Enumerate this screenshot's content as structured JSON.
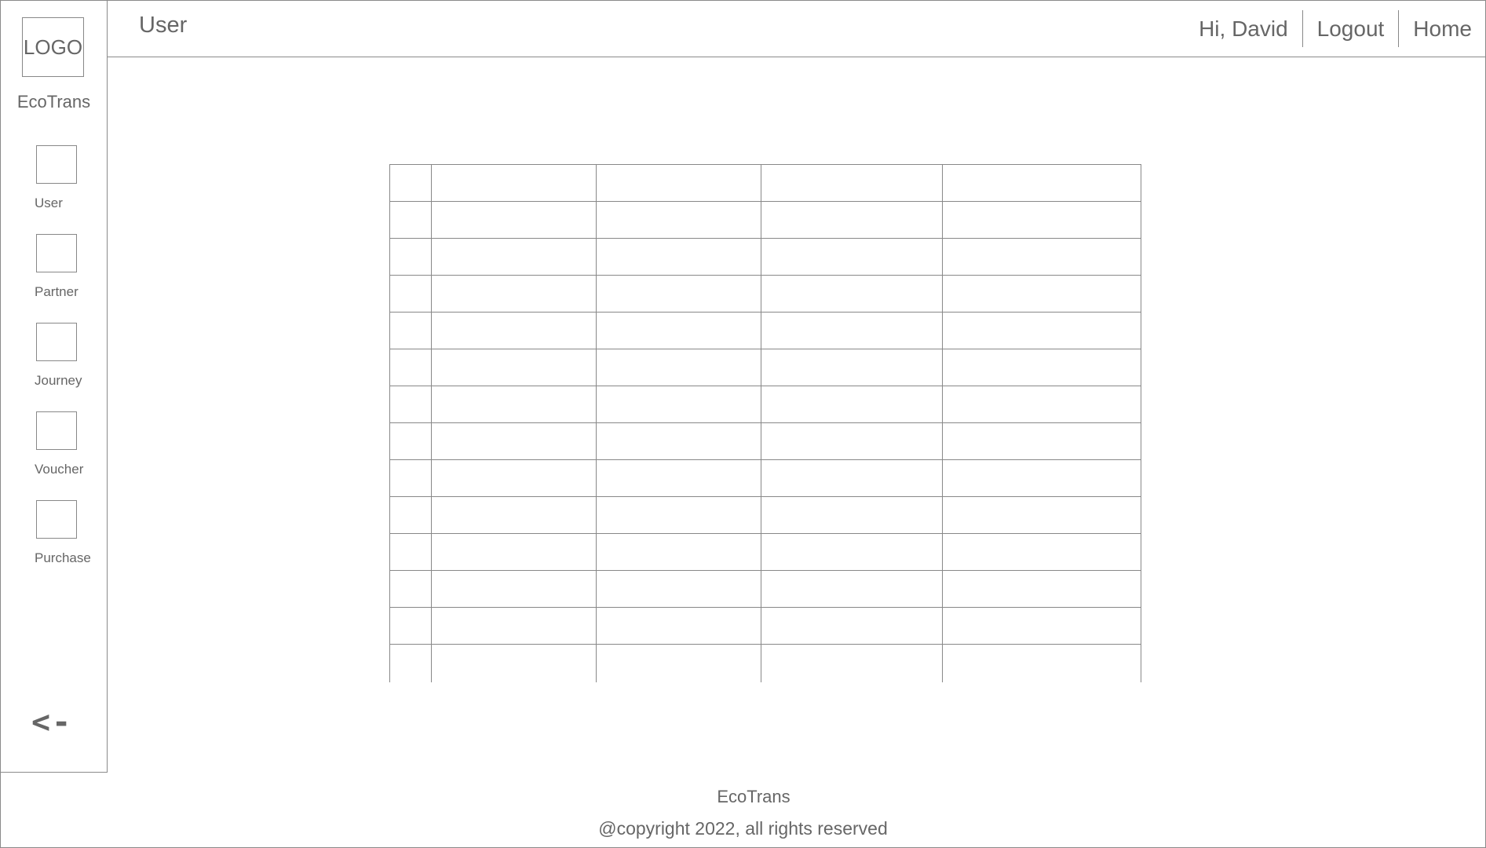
{
  "sidebar": {
    "logo_text": "LOGO",
    "brand": "EcoTrans",
    "items": [
      {
        "label": "User",
        "icon": "user-icon"
      },
      {
        "label": "Partner",
        "icon": "partner-icon"
      },
      {
        "label": "Journey",
        "icon": "journey-icon"
      },
      {
        "label": "Voucher",
        "icon": "voucher-icon"
      },
      {
        "label": "Purchase",
        "icon": "purchase-icon"
      }
    ],
    "back_label": "<-"
  },
  "header": {
    "title": "User",
    "greeting": "Hi, David",
    "logout": "Logout",
    "home": "Home"
  },
  "table": {
    "rows": 14,
    "columns": 5
  },
  "footer": {
    "brand": "EcoTrans",
    "copyright": "@copyright 2022, all rights reserved"
  }
}
